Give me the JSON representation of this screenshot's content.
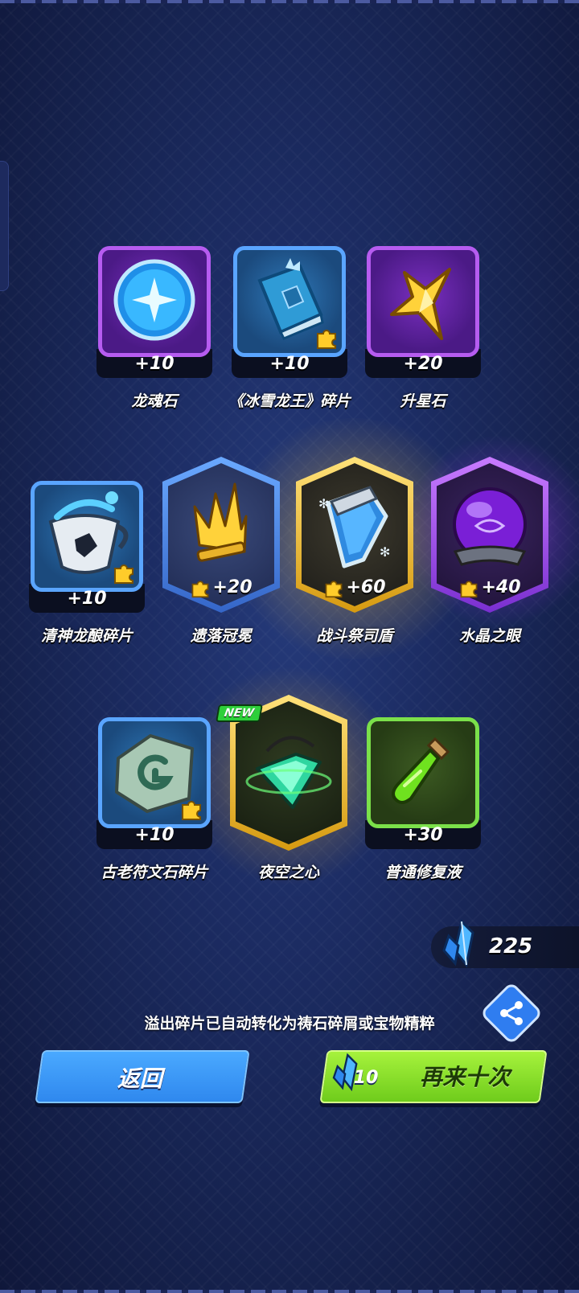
{
  "row1": [
    {
      "count": "+10",
      "name": "龙魂石"
    },
    {
      "count": "+10",
      "name": "《冰雪龙王》碎片"
    },
    {
      "count": "+20",
      "name": "升星石"
    }
  ],
  "row2": [
    {
      "count": "+10",
      "name": "清神龙酿碎片"
    },
    {
      "count": "+20",
      "name": "遗落冠冕"
    },
    {
      "count": "+60",
      "name": "战斗祭司盾"
    },
    {
      "count": "+40",
      "name": "水晶之眼"
    }
  ],
  "row3": [
    {
      "count": "+10",
      "name": "古老符文石碎片"
    },
    {
      "badge": "NEW",
      "name": "夜空之心"
    },
    {
      "count": "+30",
      "name": "普通修复液"
    }
  ],
  "currency": {
    "amount": "225"
  },
  "notice": "溢出碎片已自动转化为祷石碎屑或宝物精粹",
  "buttons": {
    "back": "返回",
    "again": "再来十次",
    "again_cost": "10"
  },
  "colors": {
    "purple": "#b65cf0",
    "blue": "#5aa5ff",
    "gold": "#ffc83a",
    "green": "#7be04a",
    "btn_blue": "#2f88ee",
    "btn_green": "#6fcc1c"
  }
}
